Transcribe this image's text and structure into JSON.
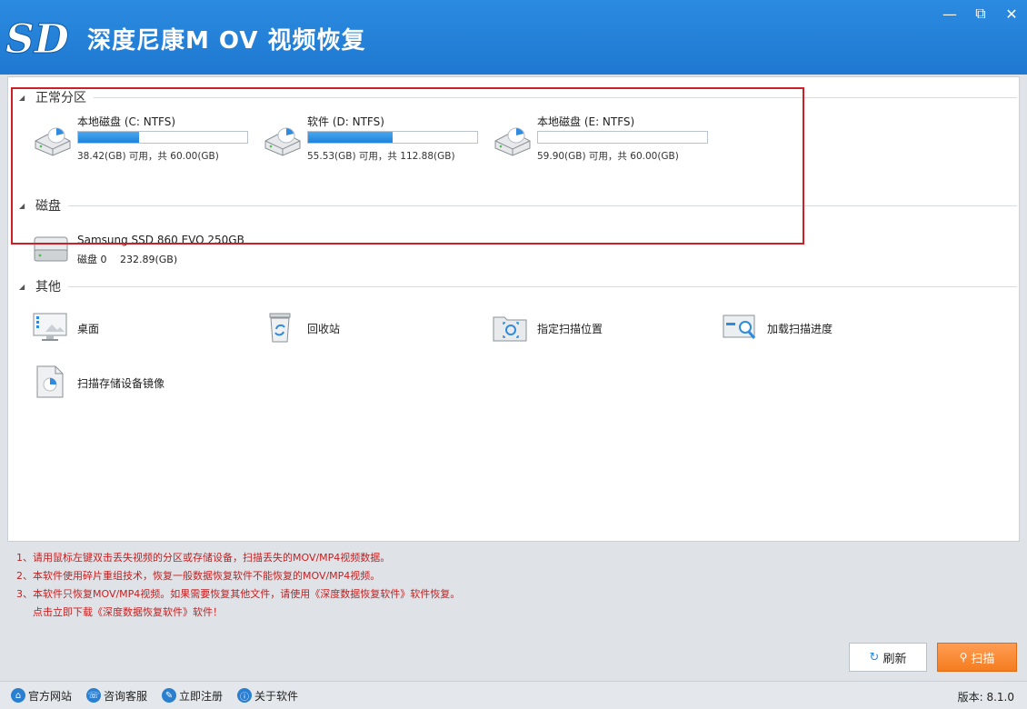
{
  "app": {
    "title": "深度尼康M OV 视频恢复",
    "logo_text": "SD"
  },
  "window_controls": {
    "minimize": "—",
    "restore": "⧉",
    "close": "✕"
  },
  "sections": {
    "normal_partitions": "正常分区",
    "disks": "磁盘",
    "others": "其他"
  },
  "drives": [
    {
      "name": "本地磁盘 (C: NTFS)",
      "capacity": "38.42(GB) 可用，共 60.00(GB)",
      "used_fraction": 0.36
    },
    {
      "name": "软件 (D: NTFS)",
      "capacity": "55.53(GB) 可用，共 112.88(GB)",
      "used_fraction": 0.5
    },
    {
      "name": "本地磁盘 (E: NTFS)",
      "capacity": "59.90(GB) 可用，共 60.00(GB)",
      "used_fraction": 0.0
    }
  ],
  "disk": {
    "name": "Samsung SSD 860 EVO 250GB",
    "capacity": "磁盘 0　 232.89(GB)"
  },
  "others": [
    {
      "label": "桌面",
      "icon": "desktop-icon"
    },
    {
      "label": "回收站",
      "icon": "recycle-bin-icon"
    },
    {
      "label": "指定扫描位置",
      "icon": "folder-target-icon"
    },
    {
      "label": "加载扫描进度",
      "icon": "load-progress-icon"
    },
    {
      "label": "扫描存储设备镜像",
      "icon": "disk-image-icon"
    }
  ],
  "tips": [
    "1、请用鼠标左键双击丢失视频的分区或存储设备，扫描丢失的MOV/MP4视频数据。",
    "2、本软件使用碎片重组技术，恢复一般数据恢复软件不能恢复的MOV/MP4视频。",
    "3、本软件只恢复MOV/MP4视频。如果需要恢复其他文件，请使用《深度数据恢复软件》软件恢复。",
    "点击立即下载《深度数据恢复软件》软件！"
  ],
  "buttons": {
    "refresh": "刷新",
    "scan": "扫描"
  },
  "statusbar": {
    "links": [
      {
        "label": "官方网站",
        "icon": "home-icon"
      },
      {
        "label": "咨询客服",
        "icon": "support-icon"
      },
      {
        "label": "立即注册",
        "icon": "register-icon"
      },
      {
        "label": "关于软件",
        "icon": "about-icon"
      }
    ],
    "version": "版本: 8.1.0"
  },
  "colors": {
    "titlebar": "#1f78d1",
    "accent_orange": "#f57c1f",
    "tip_red": "#c81e1e",
    "highlight_red": "#cc1f28"
  }
}
